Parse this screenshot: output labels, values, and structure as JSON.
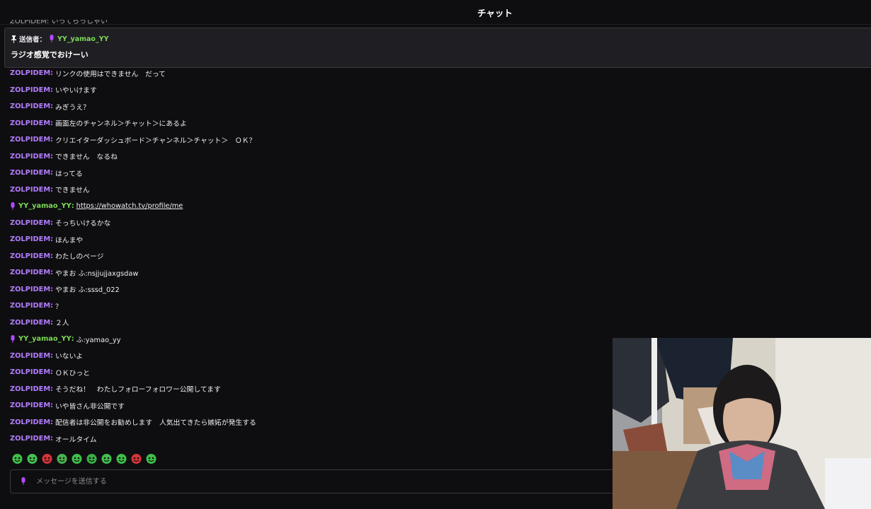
{
  "header": {
    "title": "チャット"
  },
  "top_partial_text": "ZOLPIDEM: いってらっしゃい",
  "pinned": {
    "label": "送信者：",
    "author": "YY_yamao_YY",
    "message": "ラジオ感覚でおけーい"
  },
  "messages": [
    {
      "user": "ZOLPIDEM",
      "type": "zol",
      "text": "リンクの使用はできません　だって"
    },
    {
      "user": "ZOLPIDEM",
      "type": "zol",
      "text": "いやいけます"
    },
    {
      "user": "ZOLPIDEM",
      "type": "zol",
      "text": "みぎうえ？"
    },
    {
      "user": "ZOLPIDEM",
      "type": "zol",
      "text": "画面左のチャンネル＞チャット＞にあるよ"
    },
    {
      "user": "ZOLPIDEM",
      "type": "zol",
      "text": "クリエイターダッシュボード＞チャンネル＞チャット＞　ＯＫ？"
    },
    {
      "user": "ZOLPIDEM",
      "type": "zol",
      "text": "できません　なるね"
    },
    {
      "user": "ZOLPIDEM",
      "type": "zol",
      "text": "はってる"
    },
    {
      "user": "ZOLPIDEM",
      "type": "zol",
      "text": "できません"
    },
    {
      "user": "YY_yamao_YY",
      "type": "yy",
      "text": "https://whowatch.tv/profile/me",
      "link": true
    },
    {
      "user": "ZOLPIDEM",
      "type": "zol",
      "text": "そっちいけるかな"
    },
    {
      "user": "ZOLPIDEM",
      "type": "zol",
      "text": "ほんまや"
    },
    {
      "user": "ZOLPIDEM",
      "type": "zol",
      "text": "わたしのページ"
    },
    {
      "user": "ZOLPIDEM",
      "type": "zol",
      "text": "やまお ふ:nsjjujjaxgsdaw"
    },
    {
      "user": "ZOLPIDEM",
      "type": "zol",
      "text": "やまお ふ:sssd_022"
    },
    {
      "user": "ZOLPIDEM",
      "type": "zol",
      "text": "？"
    },
    {
      "user": "ZOLPIDEM",
      "type": "zol",
      "text": "２人"
    },
    {
      "user": "YY_yamao_YY",
      "type": "yy",
      "text": "ふ:yamao_yy"
    },
    {
      "user": "ZOLPIDEM",
      "type": "zol",
      "text": "いないよ"
    },
    {
      "user": "ZOLPIDEM",
      "type": "zol",
      "text": "ＯＫひっと"
    },
    {
      "user": "ZOLPIDEM",
      "type": "zol",
      "text": "そうだね！　わたしフォローフォロワー公開してます"
    },
    {
      "user": "ZOLPIDEM",
      "type": "zol",
      "text": "いや皆さん非公開です"
    },
    {
      "user": "ZOLPIDEM",
      "type": "zol",
      "text": "配信者は非公開をお勧めします　人気出てきたら嫉妬が発生する"
    },
    {
      "user": "ZOLPIDEM",
      "type": "zol",
      "text": "オールタイム"
    }
  ],
  "emotes": [
    "green-blob",
    "green-hat",
    "red-box",
    "green-face",
    "green-wave",
    "green-plus",
    "green-smile",
    "green-chat",
    "red-mouth",
    "green-grin"
  ],
  "input": {
    "placeholder": "メッセージを送信する"
  },
  "colors": {
    "username_main": "#b47dff",
    "username_host": "#7cd957",
    "background": "#0e0e10"
  },
  "icons": {
    "pin": "pin-icon",
    "mic": "mic-icon"
  }
}
